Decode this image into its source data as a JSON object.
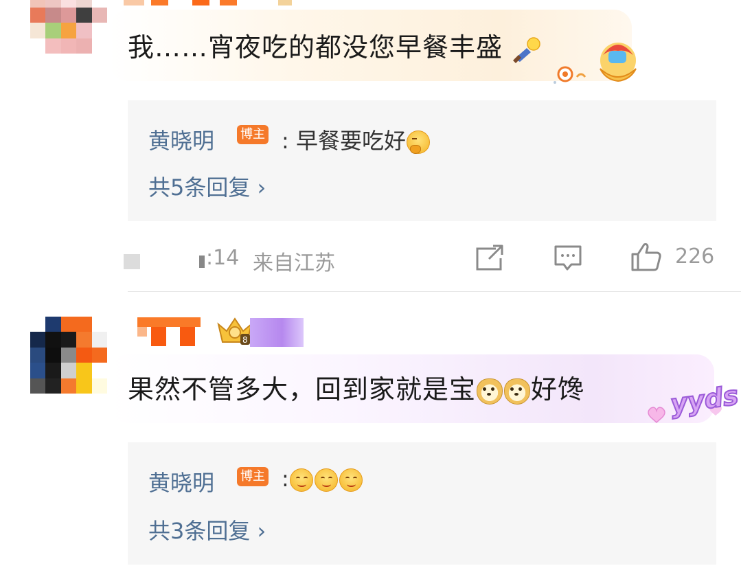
{
  "comments": [
    {
      "text": "我……宵夜吃的都没您早餐丰盛",
      "reply": {
        "author": "黄晓明",
        "badge": "博主",
        "separator": ":",
        "text": "早餐要吃好",
        "emojis": [
          "thinking-emoji"
        ],
        "more": "共5条回复 ›"
      },
      "meta": {
        "time": ":14",
        "location": "来自江苏",
        "likes": "226"
      }
    },
    {
      "text_before": "果然不管多大，回到家就是宝",
      "text_after": "好馋",
      "emojis": [
        "doge-emoji",
        "doge-emoji"
      ],
      "sticker": "yyds",
      "reply": {
        "author": "黄晓明",
        "badge": "博主",
        "separator": ":",
        "emojis": [
          "smile-emoji",
          "smile-emoji",
          "smile-emoji"
        ],
        "more": "共3条回复 ›"
      }
    }
  ],
  "colors": {
    "link": "#4f6f93",
    "badge": "#f5792a",
    "reply_bg": "#f6f6f6",
    "meta": "#9a9a9a"
  }
}
